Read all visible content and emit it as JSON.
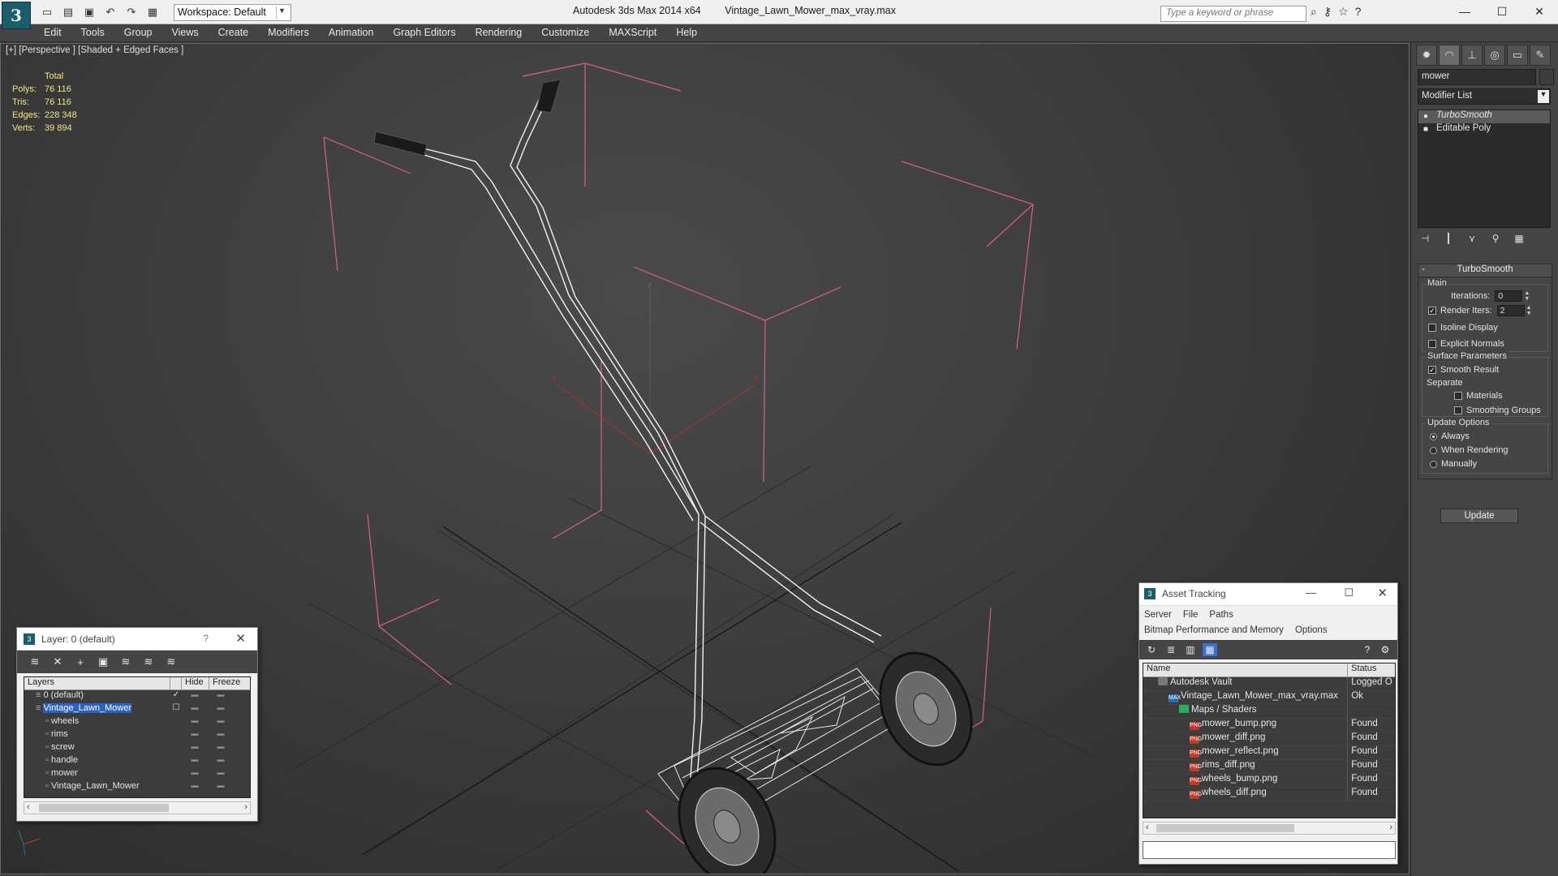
{
  "titlebar": {
    "app_title": "Autodesk 3ds Max  2014 x64",
    "file_title": "Vintage_Lawn_Mower_max_vray.max",
    "workspace": "Workspace: Default",
    "search_placeholder": "Type a keyword or phrase",
    "logo_glyph": "3"
  },
  "menu": [
    "Edit",
    "Tools",
    "Group",
    "Views",
    "Create",
    "Modifiers",
    "Animation",
    "Graph Editors",
    "Rendering",
    "Customize",
    "MAXScript",
    "Help"
  ],
  "viewport": {
    "label": "[+] [Perspective ] [Shaded + Edged Faces ]",
    "stats": {
      "header": "Total",
      "rows": [
        {
          "label": "Polys:",
          "value": "76 116"
        },
        {
          "label": "Tris:",
          "value": "76 116"
        },
        {
          "label": "Edges:",
          "value": "228 348"
        },
        {
          "label": "Verts:",
          "value": "39 894"
        }
      ]
    },
    "axis_labels": {
      "x": "x",
      "y": "y",
      "z": "z"
    }
  },
  "command_panel": {
    "object_name": "mower",
    "modifier_list": "Modifier List",
    "stack": [
      {
        "label": "TurboSmooth",
        "active": true
      },
      {
        "label": "Editable Poly",
        "active": false
      }
    ],
    "rollout": {
      "title": "TurboSmooth",
      "main_label": "Main",
      "iterations_label": "Iterations:",
      "iterations_value": "0",
      "render_iters_label": "Render Iters:",
      "render_iters_value": "2",
      "isoline": "Isoline Display",
      "explicit_normals": "Explicit Normals",
      "surface_label": "Surface Parameters",
      "smooth_result": "Smooth Result",
      "separate_label": "Separate",
      "materials": "Materials",
      "smoothing_groups": "Smoothing Groups",
      "update_options": "Update Options",
      "always": "Always",
      "when_rendering": "When Rendering",
      "manually": "Manually",
      "update_button": "Update"
    }
  },
  "layer_window": {
    "title": "Layer: 0 (default)",
    "help": "?",
    "columns": {
      "layers": "Layers",
      "hide": "Hide",
      "freeze": "Freeze"
    },
    "rows": [
      {
        "name": "0 (default)",
        "level": 0,
        "selected": false
      },
      {
        "name": "Vintage_Lawn_Mower",
        "level": 0,
        "selected": true
      },
      {
        "name": "wheels",
        "level": 1,
        "selected": false
      },
      {
        "name": "rims",
        "level": 1,
        "selected": false
      },
      {
        "name": "screw",
        "level": 1,
        "selected": false
      },
      {
        "name": "handle",
        "level": 1,
        "selected": false
      },
      {
        "name": "mower",
        "level": 1,
        "selected": false
      },
      {
        "name": "Vintage_Lawn_Mower",
        "level": 1,
        "selected": false
      }
    ]
  },
  "asset_window": {
    "title": "Asset Tracking",
    "menu1": [
      "Server",
      "File",
      "Paths"
    ],
    "menu2": [
      "Bitmap Performance and Memory",
      "Options"
    ],
    "columns": {
      "name": "Name",
      "status": "Status"
    },
    "rows": [
      {
        "name": "Autodesk Vault",
        "status": "Logged O",
        "level": 0,
        "icon": "vault"
      },
      {
        "name": "Vintage_Lawn_Mower_max_vray.max",
        "status": "Ok",
        "level": 1,
        "icon": "max"
      },
      {
        "name": "Maps / Shaders",
        "status": "",
        "level": 2,
        "icon": "maps"
      },
      {
        "name": "mower_bump.png",
        "status": "Found",
        "level": 3,
        "icon": "png"
      },
      {
        "name": "mower_diff.png",
        "status": "Found",
        "level": 3,
        "icon": "png"
      },
      {
        "name": "mower_reflect.png",
        "status": "Found",
        "level": 3,
        "icon": "png"
      },
      {
        "name": "rims_diff.png",
        "status": "Found",
        "level": 3,
        "icon": "png"
      },
      {
        "name": "wheels_bump.png",
        "status": "Found",
        "level": 3,
        "icon": "png"
      },
      {
        "name": "wheels_diff.png",
        "status": "Found",
        "level": 3,
        "icon": "png"
      }
    ]
  },
  "colors": {
    "stats_text": "#f1e68a",
    "selection_blue": "#2a63c4",
    "bbox_pink": "#d8608a",
    "wire_white": "#f2f2f2"
  }
}
